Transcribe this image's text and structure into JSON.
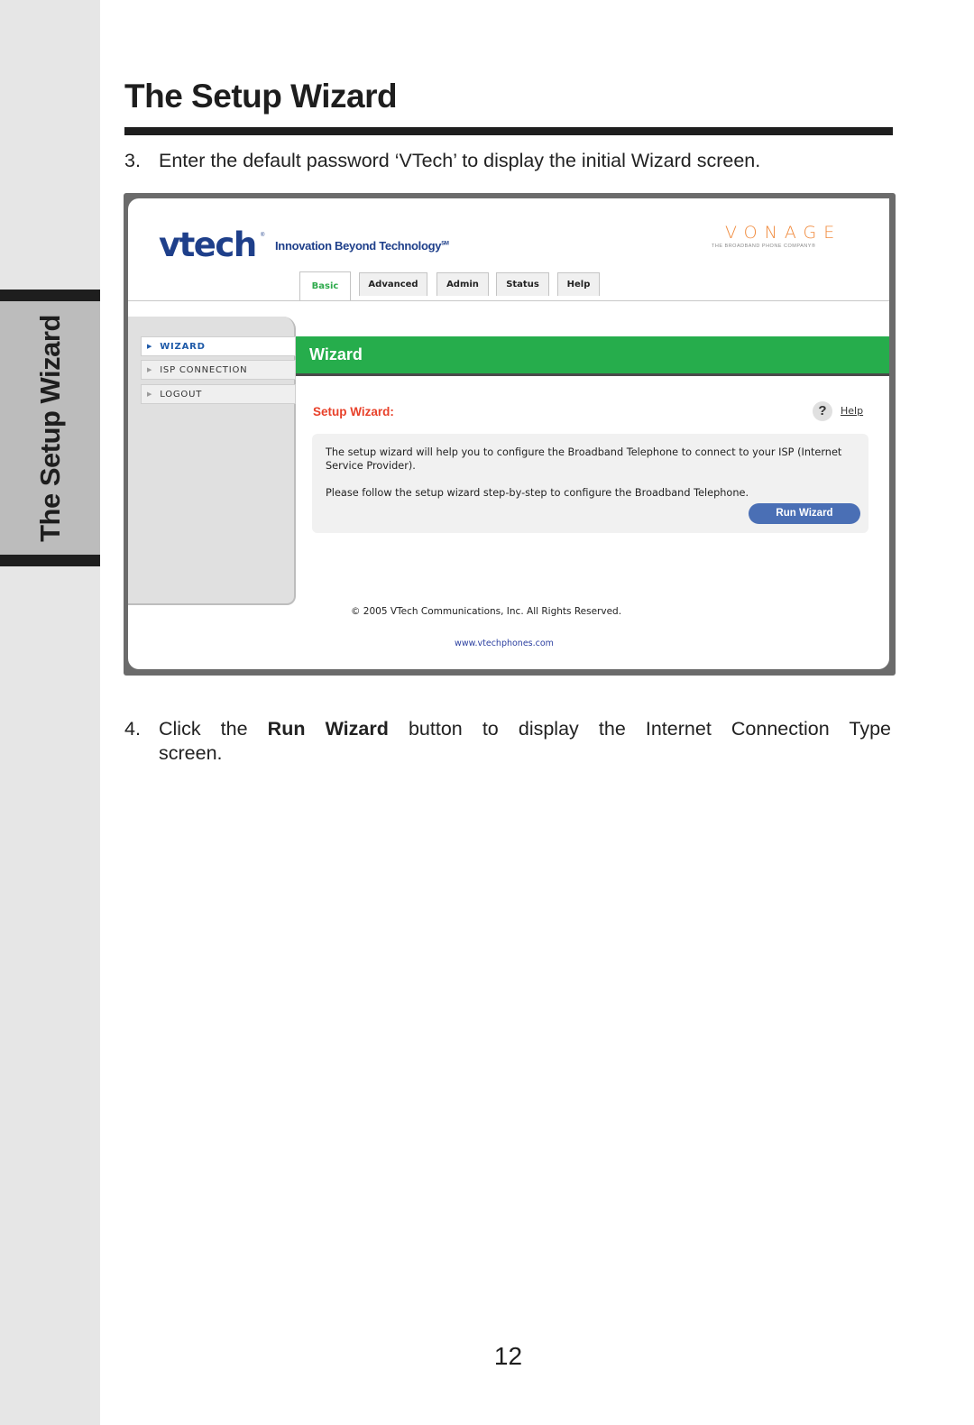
{
  "side_tab": {
    "label": "The Setup Wizard"
  },
  "page": {
    "title": "The Setup Wizard",
    "step3": {
      "number": "3.",
      "text": "Enter the default password ‘VTech’ to display the initial Wizard screen."
    },
    "step4": {
      "number": "4.",
      "pre": "Click  the ",
      "bold": "Run  Wizard",
      "post": " button  to  display  the  Internet  Connection  Type",
      "line2": "screen."
    },
    "page_number": "12"
  },
  "screenshot": {
    "logo": "vtech",
    "logo_reg": "®",
    "tagline": "Innovation Beyond Technology",
    "tagline_mark": "SM",
    "partner_logo": "VONAGE",
    "partner_sub": "THE BROADBAND PHONE COMPANY®",
    "tabs": [
      {
        "label": "Basic",
        "active": true
      },
      {
        "label": "Advanced",
        "active": false
      },
      {
        "label": "Admin",
        "active": false
      },
      {
        "label": "Status",
        "active": false
      },
      {
        "label": "Help",
        "active": false
      }
    ],
    "nav": [
      {
        "label": "WIZARD",
        "icon": "triangle-right-icon",
        "active": true
      },
      {
        "label": "ISP CONNECTION",
        "icon": "triangle-right-icon",
        "active": false
      },
      {
        "label": "LOGOUT",
        "icon": "triangle-right-icon",
        "active": false
      }
    ],
    "section_header": "Wizard",
    "setup_title": "Setup Wizard:",
    "help_icon": "?",
    "help_link": "Help",
    "info_p1": "The setup wizard will help you to configure the Broadband Telephone to connect to your ISP (Internet Service Provider).",
    "info_p2": "Please follow the setup wizard step-by-step to configure the Broadband Telephone.",
    "run_button": "Run Wizard",
    "copyright": "© 2005 VTech Communications, Inc. All Rights Reserved.",
    "website": "www.vtechphones.com",
    "colors": {
      "green": "#26ad4c",
      "brand_blue": "#1e3f8a",
      "red_title": "#e8412a",
      "button_blue": "#4a6fb5",
      "vonage_orange": "#f08a3c"
    }
  }
}
